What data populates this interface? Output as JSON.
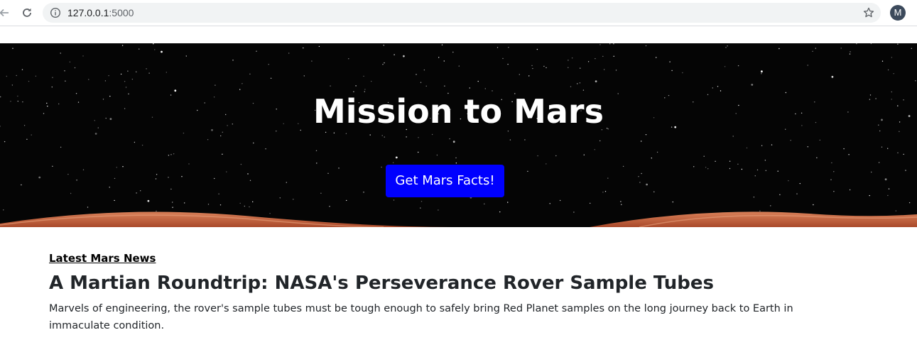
{
  "browser": {
    "url_host": "127.0.0.1",
    "url_port": ":5000",
    "profile_initial": "M"
  },
  "hero": {
    "title": "Mission to Mars",
    "button_label": "Get Mars Facts!"
  },
  "news": {
    "section_label": "Latest Mars News",
    "headline": "A Martian Roundtrip: NASA's Perseverance Rover Sample Tubes",
    "teaser": "Marvels of engineering, the rover's sample tubes must be tough enough to safely bring Red Planet samples on the long journey back to Earth in immaculate condition."
  },
  "colors": {
    "button_bg": "#0000ff",
    "hero_bg": "#050505",
    "mars_surface": "#c8613a"
  },
  "icons": [
    "back-arrow-icon",
    "reload-icon",
    "info-icon",
    "bookmark-star-icon"
  ]
}
